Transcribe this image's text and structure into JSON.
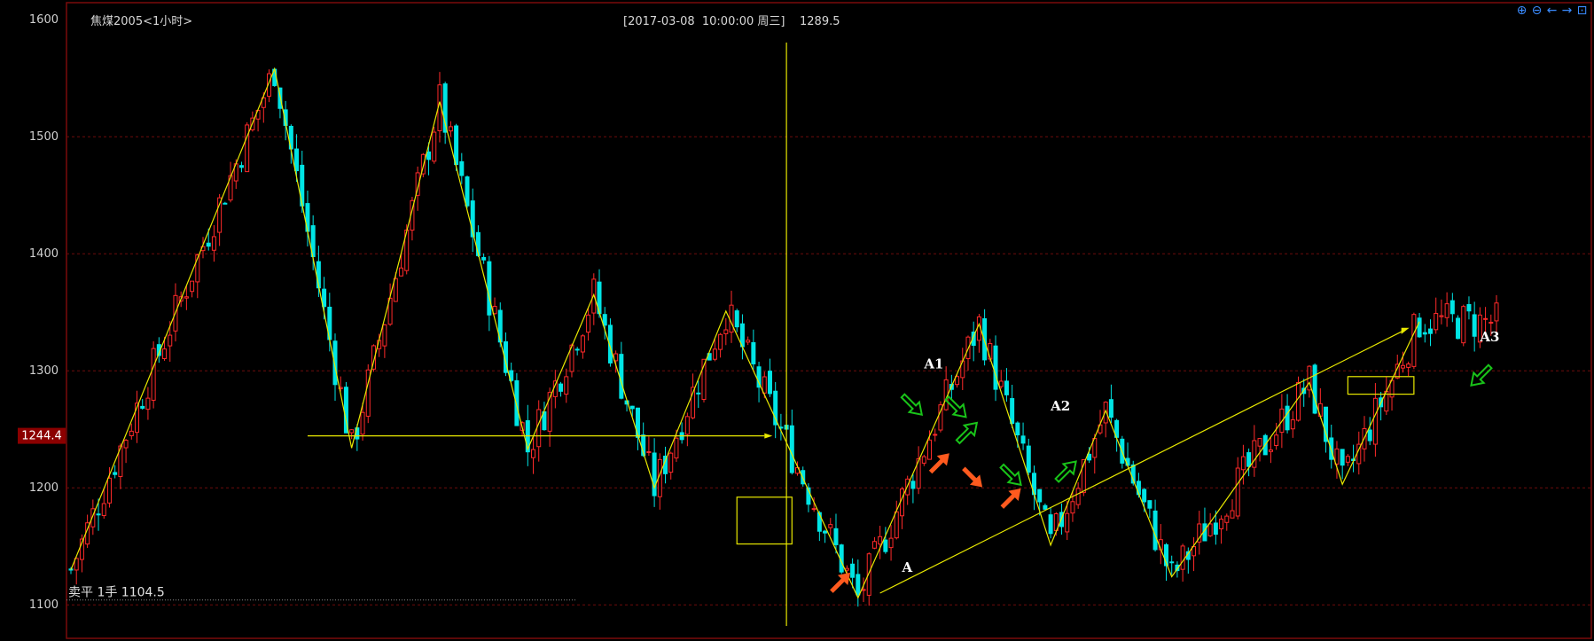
{
  "header": {
    "title": "焦煤2005<1小时>",
    "cursor_info": "[2017-03-08  10:00:00 周三]    1289.5"
  },
  "toolbar": {
    "icons": [
      "zoom-in-icon",
      "zoom-out-icon",
      "scroll-left-icon",
      "scroll-right-icon",
      "restore-icon"
    ],
    "glyphs": [
      "⊕",
      "⊖",
      "←",
      "→",
      "⊡"
    ]
  },
  "colors": {
    "background": "#000000",
    "frame": "#7a0a0a",
    "grid": "#6e0c0c",
    "candle_up": "#ff2a2a",
    "candle_down": "#00e5e5",
    "overlay": "#e8e800",
    "arrow_green": "#19c419",
    "arrow_orange": "#ff5a1e",
    "axis_text": "#cfcfcf",
    "price_tag_bg": "#8b0000"
  },
  "chart_data": {
    "type": "candlestick",
    "ylim": [
      1085,
      1610
    ],
    "y_ticks": [
      1100,
      1200,
      1300,
      1400,
      1500,
      1600
    ],
    "bar_count": 260,
    "price_tag": "1244.4",
    "cursor_bar": 130,
    "order_label": "卖平 1手",
    "order_price": "1104.5",
    "zigzag": [
      {
        "bar": 0,
        "price": 1130
      },
      {
        "bar": 37,
        "price": 1558
      },
      {
        "bar": 51,
        "price": 1234
      },
      {
        "bar": 67,
        "price": 1530
      },
      {
        "bar": 83,
        "price": 1233
      },
      {
        "bar": 95,
        "price": 1365
      },
      {
        "bar": 106,
        "price": 1200
      },
      {
        "bar": 119,
        "price": 1351
      },
      {
        "bar": 143,
        "price": 1106
      },
      {
        "bar": 165,
        "price": 1340
      },
      {
        "bar": 178,
        "price": 1151
      },
      {
        "bar": 188,
        "price": 1266
      },
      {
        "bar": 200,
        "price": 1124
      },
      {
        "bar": 225,
        "price": 1290
      },
      {
        "bar": 231,
        "price": 1203
      },
      {
        "bar": 245,
        "price": 1342
      }
    ],
    "horizontal_line": {
      "bar_from": 43,
      "bar_to": 126,
      "price": 1244.4
    },
    "trend_line": {
      "from": {
        "bar": 147,
        "price": 1110
      },
      "to": {
        "bar": 242,
        "price": 1334
      }
    },
    "boxes": [
      {
        "bar_from": 121,
        "bar_to": 131,
        "price_top": 1192,
        "price_bottom": 1152
      },
      {
        "bar_from": 232,
        "bar_to": 244,
        "price_top": 1295,
        "price_bottom": 1280
      }
    ],
    "labels": [
      {
        "text": "A",
        "bar": 151,
        "price": 1128
      },
      {
        "text": "A1",
        "bar": 155,
        "price": 1302
      },
      {
        "text": "A2",
        "bar": 178,
        "price": 1266
      },
      {
        "text": "A3",
        "bar": 256,
        "price": 1325
      }
    ],
    "arrows": [
      {
        "color": "orange",
        "dir": "up-right",
        "bar": 140,
        "price": 1120
      },
      {
        "color": "orange",
        "dir": "up-right",
        "bar": 158,
        "price": 1222
      },
      {
        "color": "orange",
        "dir": "down-right",
        "bar": 164,
        "price": 1208
      },
      {
        "color": "orange",
        "dir": "up-right",
        "bar": 171,
        "price": 1192
      },
      {
        "color": "green",
        "dir": "down-right",
        "bar": 153,
        "price": 1270
      },
      {
        "color": "green",
        "dir": "down-right",
        "bar": 161,
        "price": 1268
      },
      {
        "color": "green",
        "dir": "up-right",
        "bar": 163,
        "price": 1248
      },
      {
        "color": "green",
        "dir": "down-right",
        "bar": 171,
        "price": 1210
      },
      {
        "color": "green",
        "dir": "up-right",
        "bar": 181,
        "price": 1215
      },
      {
        "color": "green",
        "dir": "down-left",
        "bar": 256,
        "price": 1295
      }
    ]
  }
}
